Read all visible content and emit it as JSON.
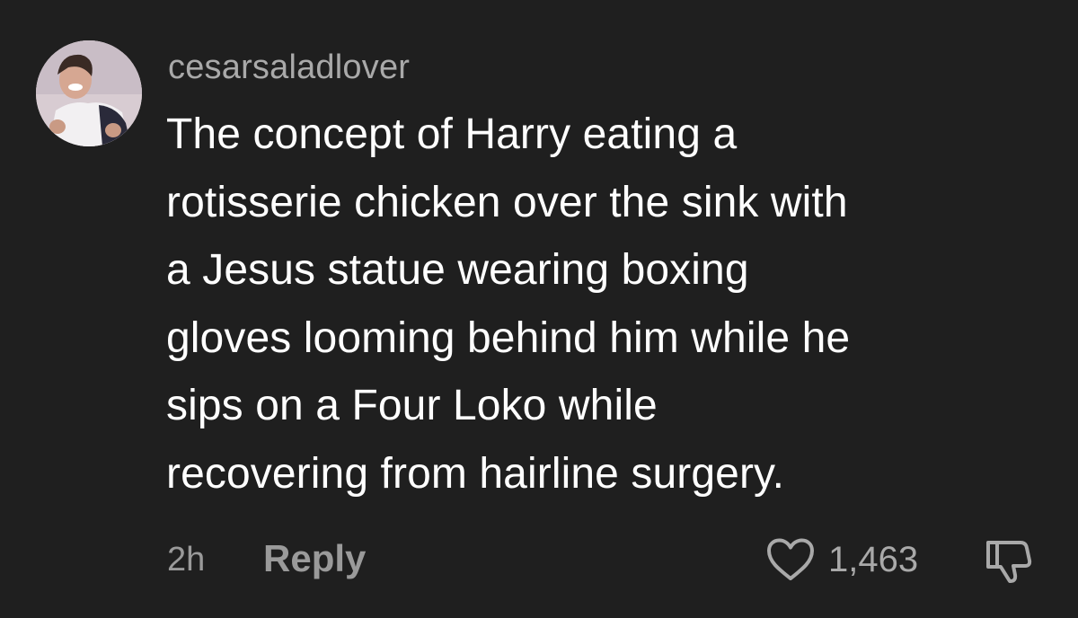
{
  "comment": {
    "username": "cesarsaladlover",
    "avatar_icon": "profile-photo",
    "text_lines": [
      "The concept of Harry eating a",
      "rotisserie chicken over the sink with",
      "a Jesus statue wearing boxing",
      "gloves looming behind him while he",
      "sips on a Four Loko while",
      "recovering from hairline surgery."
    ],
    "timestamp": "2h",
    "reply_label": "Reply",
    "like_count": "1,463",
    "like_icon": "heart-icon",
    "dislike_icon": "thumbs-down-icon"
  },
  "colors": {
    "background": "#1f1f1f",
    "text": "#ffffff",
    "muted": "#9a9a9a"
  }
}
